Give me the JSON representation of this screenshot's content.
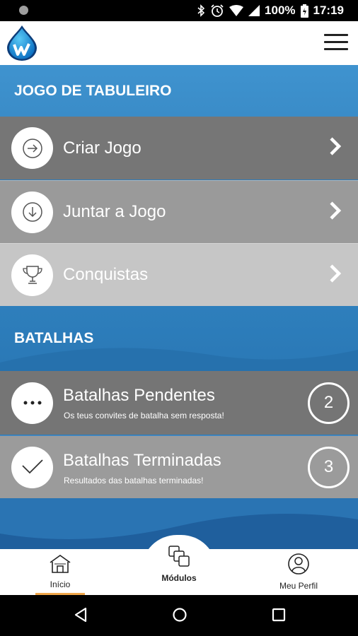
{
  "status_bar": {
    "battery_percent": "100%",
    "time": "17:19"
  },
  "colors": {
    "header_blue": "#3f93cf",
    "section_blue": "#2b7dbd",
    "dark_blue": "#1f5f9d",
    "row_dark": "#767676",
    "row_mid": "#9a9a9a",
    "row_light": "#c6c6c6",
    "active_tab": "#f0a64a"
  },
  "board_game": {
    "title": "JOGO DE TABULEIRO",
    "items": [
      {
        "label": "Criar Jogo",
        "icon": "arrow-right-circle-icon"
      },
      {
        "label": "Juntar a Jogo",
        "icon": "arrow-down-circle-icon"
      },
      {
        "label": "Conquistas",
        "icon": "trophy-icon"
      }
    ]
  },
  "battles": {
    "title": "BATALHAS",
    "items": [
      {
        "label": "Batalhas Pendentes",
        "subtitle": "Os teus convites de batalha sem resposta!",
        "count": "2",
        "icon": "more-dots-icon"
      },
      {
        "label": "Batalhas Terminadas",
        "subtitle": "Resultados das batalhas terminadas!",
        "count": "3",
        "icon": "checkmark-icon"
      }
    ]
  },
  "bottom_nav": {
    "items": [
      {
        "label": "Início",
        "icon": "home-icon",
        "active": true
      },
      {
        "label": "Módulos",
        "icon": "modules-icon",
        "active": false
      },
      {
        "label": "Meu Perfil",
        "icon": "profile-icon",
        "active": false
      }
    ]
  }
}
